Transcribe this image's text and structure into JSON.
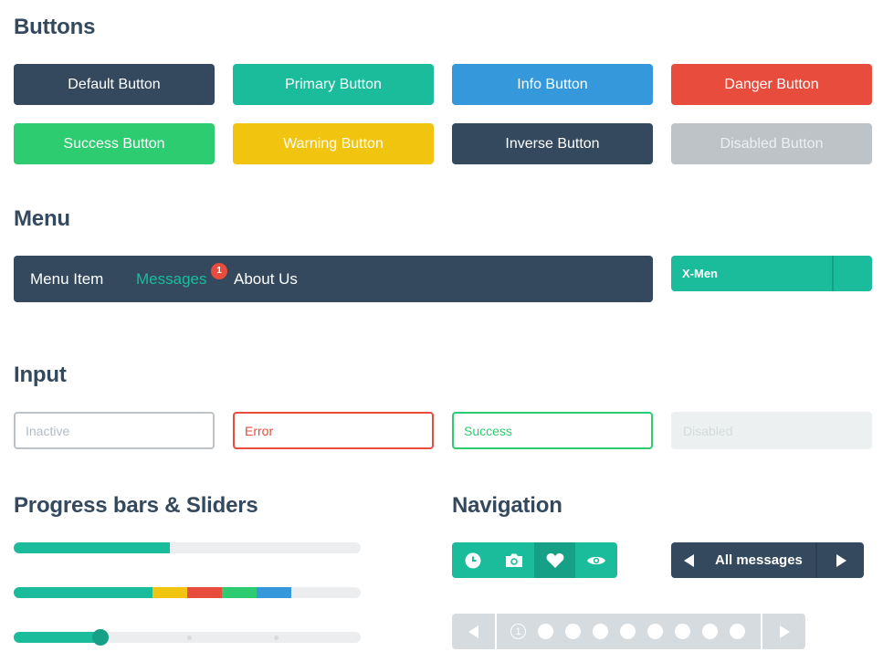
{
  "sections": {
    "buttons": "Buttons",
    "menu": "Menu",
    "input": "Input",
    "progress": "Progress bars & Sliders",
    "navigation": "Navigation"
  },
  "buttons": {
    "default": "Default Button",
    "primary": "Primary Button",
    "info": "Info Button",
    "danger": "Danger Button",
    "success": "Success Button",
    "warning": "Warning Button",
    "inverse": "Inverse Button",
    "disabled": "Disabled Button"
  },
  "menu": {
    "items": [
      "Menu Item",
      "Messages",
      "About Us"
    ],
    "active": "Messages",
    "badge": "1",
    "dropdown_label": "X-Men"
  },
  "inputs": {
    "inactive": "Inactive",
    "error": "Error",
    "success": "Success",
    "disabled": "Disabled"
  },
  "progress": {
    "bar1_percent": 45,
    "bar2_segments": [
      {
        "color": "#1abc9c",
        "percent": 40
      },
      {
        "color": "#f1c40f",
        "percent": 10
      },
      {
        "color": "#e74c3c",
        "percent": 10
      },
      {
        "color": "#2ecc71",
        "percent": 10
      },
      {
        "color": "#3498db",
        "percent": 10
      }
    ],
    "slider_percent": 25,
    "slider_ticks": 2
  },
  "navigation": {
    "icons": [
      "clock-icon",
      "camera-icon",
      "heart-icon",
      "eye-icon"
    ],
    "active_icon": "heart-icon",
    "all_messages": "All messages",
    "pages": [
      "1",
      "",
      "",
      "",
      "",
      "",
      "",
      "",
      ""
    ],
    "current_page": "1"
  },
  "colors": {
    "dark": "#34495e",
    "turquoise": "#1abc9c",
    "green_sea": "#16a085",
    "info": "#3498db",
    "danger": "#e74c3c",
    "success": "#2ecc71",
    "warning": "#f1c40f",
    "disabled": "#bdc3c7"
  }
}
